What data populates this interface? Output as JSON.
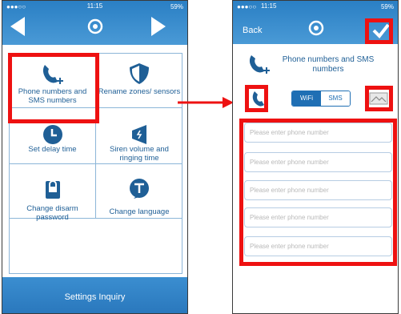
{
  "left_screen": {
    "status": {
      "carrier": "●●●○○",
      "time": "11:15",
      "battery": "59%"
    },
    "nav": {
      "back_icon": "triangle-left",
      "logo_icon": "lock-logo",
      "forward_icon": "triangle-right"
    },
    "menu_items": [
      {
        "label": "Phone numbers and SMS numbers",
        "icon": "phone-plus-icon"
      },
      {
        "label": "Rename zones/ sensors",
        "icon": "shield-icon"
      },
      {
        "label": "Set delay time",
        "icon": "clock-icon"
      },
      {
        "label": "Siren volume and ringing time",
        "icon": "speaker-icon"
      },
      {
        "label": "Change disarm password",
        "icon": "lock-icon"
      },
      {
        "label": "Change language",
        "icon": "language-icon"
      }
    ],
    "footer_label": "Settings Inquiry"
  },
  "right_screen": {
    "status": {
      "carrier": "●●●○○",
      "time": "11:15",
      "battery": "59%"
    },
    "header": {
      "back_label": "Back",
      "confirm_icon": "checkmark-icon"
    },
    "title": "Phone numbers and SMS numbers",
    "toggle": {
      "wifi_label": "WiFi",
      "sms_label": "SMS",
      "selected": "WiFi"
    },
    "inputs": [
      {
        "placeholder": "Please enter phone number"
      },
      {
        "placeholder": "Please enter phone number"
      },
      {
        "placeholder": "Please enter phone number"
      },
      {
        "placeholder": "Please enter phone number"
      },
      {
        "placeholder": "Please enter phone number"
      }
    ]
  },
  "colors": {
    "brand_blue": "#2a7fc4",
    "highlight_red": "#ee1111",
    "text_blue": "#1f5f96"
  }
}
